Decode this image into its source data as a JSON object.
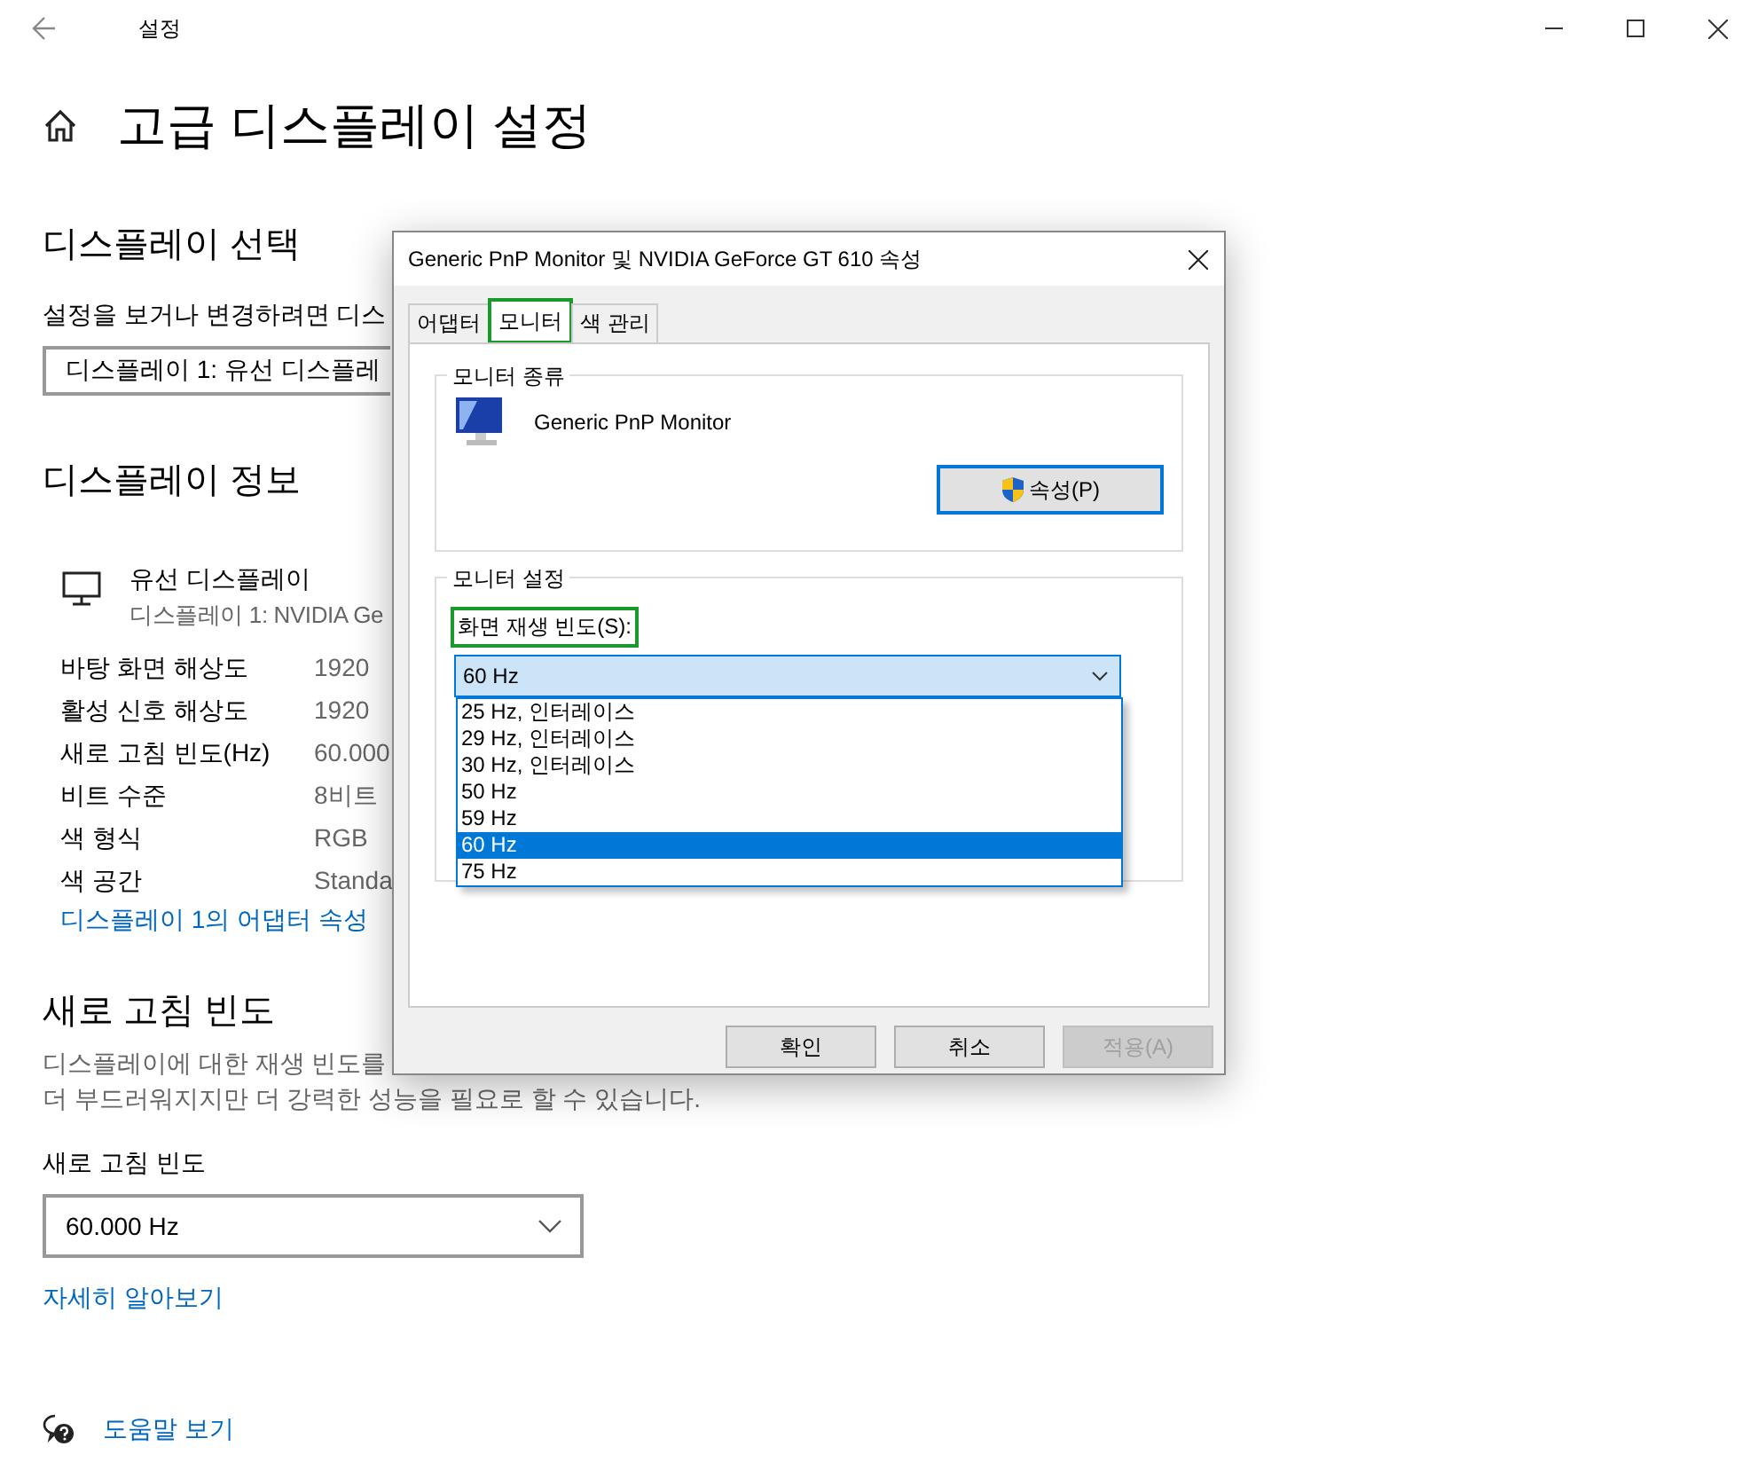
{
  "window": {
    "title": "설정"
  },
  "page_title": "고급 디스플레이 설정",
  "display_select": {
    "heading": "디스플레이 선택",
    "label": "설정을 보거나 변경하려면 디스",
    "value": "디스플레이 1: 유선 디스플레"
  },
  "display_info": {
    "heading": "디스플레이 정보",
    "device_name": "유선 디스플레이",
    "device_detail": "디스플레이 1: NVIDIA Ge",
    "rows": [
      {
        "label": "바탕 화면 해상도",
        "value": "1920"
      },
      {
        "label": "활성 신호 해상도",
        "value": "1920"
      },
      {
        "label": "새로 고침 빈도(Hz)",
        "value": "60.000"
      },
      {
        "label": "비트 수준",
        "value": "8비트"
      },
      {
        "label": "색 형식",
        "value": "RGB"
      },
      {
        "label": "색 공간",
        "value": "Standa"
      }
    ],
    "link": "디스플레이 1의 어댑터 속성"
  },
  "refresh_rate": {
    "heading": "새로 고침 빈도",
    "description_line1": "디스플레이에 대한 재생 빈도를",
    "description_line2": "더 부드러워지지만 더 강력한 성능을 필요로 할 수 있습니다.",
    "label": "새로 고침 빈도",
    "value": "60.000 Hz",
    "link": "자세히 알아보기"
  },
  "help_link": "도움말 보기",
  "dialog": {
    "title": "Generic PnP Monitor 및 NVIDIA GeForce GT 610 속성",
    "tabs": [
      {
        "label": "어댑터",
        "selected": false,
        "highlighted": false
      },
      {
        "label": "모니터",
        "selected": true,
        "highlighted": true
      },
      {
        "label": "색 관리",
        "selected": false,
        "highlighted": false
      }
    ],
    "monitor_type": {
      "legend": "모니터 종류",
      "name": "Generic PnP Monitor",
      "button": "속성(P)",
      "button_focused": true
    },
    "monitor_settings": {
      "legend": "모니터 설정",
      "label": "화면 재생 빈도(S):",
      "label_highlighted": true,
      "value": "60 Hz",
      "expanded": true,
      "options": [
        {
          "label": "25 Hz, 인터레이스",
          "selected": false
        },
        {
          "label": "29 Hz, 인터레이스",
          "selected": false
        },
        {
          "label": "30 Hz, 인터레이스",
          "selected": false
        },
        {
          "label": "50 Hz",
          "selected": false
        },
        {
          "label": "59 Hz",
          "selected": false
        },
        {
          "label": "60 Hz",
          "selected": true
        },
        {
          "label": "75 Hz",
          "selected": false
        }
      ]
    },
    "buttons": [
      {
        "label": "확인",
        "disabled": false
      },
      {
        "label": "취소",
        "disabled": false
      },
      {
        "label": "적용(A)",
        "disabled": true
      }
    ]
  }
}
